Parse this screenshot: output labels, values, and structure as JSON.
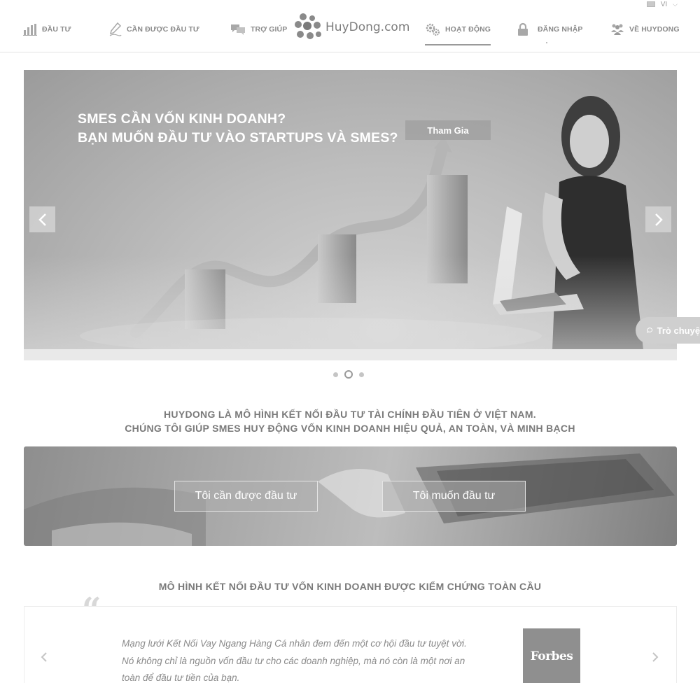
{
  "header": {
    "language": "VI",
    "logo_text": "HuyDong.com",
    "nav_left": [
      {
        "label": "ĐẦU TƯ",
        "icon": "bar-chart-icon"
      },
      {
        "label": "CẦN ĐƯỢC ĐẦU TƯ",
        "icon": "pen-icon"
      },
      {
        "label": "TRỢ GIÚP",
        "icon": "chat-bubbles-icon"
      }
    ],
    "nav_right": [
      {
        "label": "HOẠT ĐỘNG",
        "icon": "gears-icon",
        "active": true
      },
      {
        "label": "ĐĂNG NHẬP",
        "icon": "lock-icon"
      },
      {
        "label": "VỀ HUYDONG",
        "icon": "people-icon"
      }
    ]
  },
  "hero": {
    "title_line1": "SMES CẦN VỐN KINH DOANH?",
    "title_line2": "BẠN MUỐN ĐẦU TƯ VÀO STARTUPS VÀ SMES?",
    "cta_label": "Tham Gia",
    "slides_total": 3,
    "active_slide": 2
  },
  "chat": {
    "label": "Trò chuyện"
  },
  "mission": {
    "line1": "HUYDONG LÀ MÔ HÌNH KẾT NỐI ĐẦU TƯ TÀI CHÍNH ĐẦU TIÊN Ở VIỆT NAM.",
    "line2": "CHÚNG TÔI GIÚP SMES HUY ĐỘNG VỐN KINH DOANH HIỆU QUẢ, AN TOÀN, VÀ MINH BẠCH"
  },
  "band": {
    "need_investment_label": "Tôi cần được đầu tư",
    "want_invest_label": "Tôi muốn đầu tư"
  },
  "testimonial": {
    "section_title": "MÔ HÌNH KẾT NỐI ĐẦU TƯ VỐN KINH DOANH ĐƯỢC KIỂM CHỨNG TOÀN CẦU",
    "quote_mark": "“",
    "quote_line1": "Mạng lưới Kết Nối Vay Ngang Hàng Cá nhân đem đến một cơ hội đầu tư tuyệt vời.",
    "quote_line2": "Nó không chỉ là nguồn vốn đầu tư cho các doanh nghiệp, mà nó còn là một nơi an",
    "quote_line3": "toàn để đầu tư tiền của bạn.",
    "source_logo": "Forbes"
  },
  "colors": {
    "text_gray": "#7a7a7a",
    "nav_gray": "#8a8a8a",
    "hero_bg": "#bdbdbd"
  }
}
